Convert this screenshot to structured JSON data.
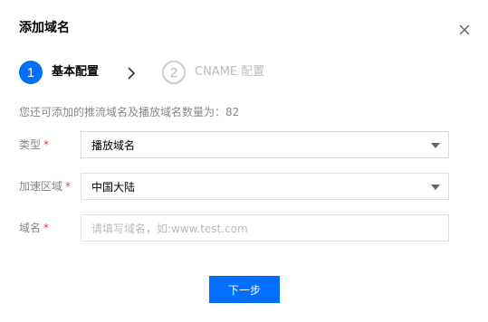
{
  "dialog": {
    "title": "添加域名",
    "close_icon": "close-icon"
  },
  "steps": [
    {
      "number": "1",
      "label": "基本配置",
      "state": "active"
    },
    {
      "number": "2",
      "label": "CNAME 配置",
      "state": "inactive"
    }
  ],
  "step_separator_icon": "chevron-right-icon",
  "quota_text": "您还可添加的推流域名及播放域名数量为：82",
  "form": {
    "type": {
      "label": "类型",
      "required_mark": "*",
      "value": "播放域名"
    },
    "region": {
      "label": "加速区域",
      "required_mark": "*",
      "value": "中国大陆"
    },
    "domain": {
      "label": "域名",
      "required_mark": "*",
      "value": "",
      "placeholder": "请填写域名，如:www.test.com"
    }
  },
  "next_button": "下一步",
  "colors": {
    "primary": "#006eff",
    "required": "#e54545",
    "muted_text": "#888888",
    "border": "#dddddd"
  }
}
